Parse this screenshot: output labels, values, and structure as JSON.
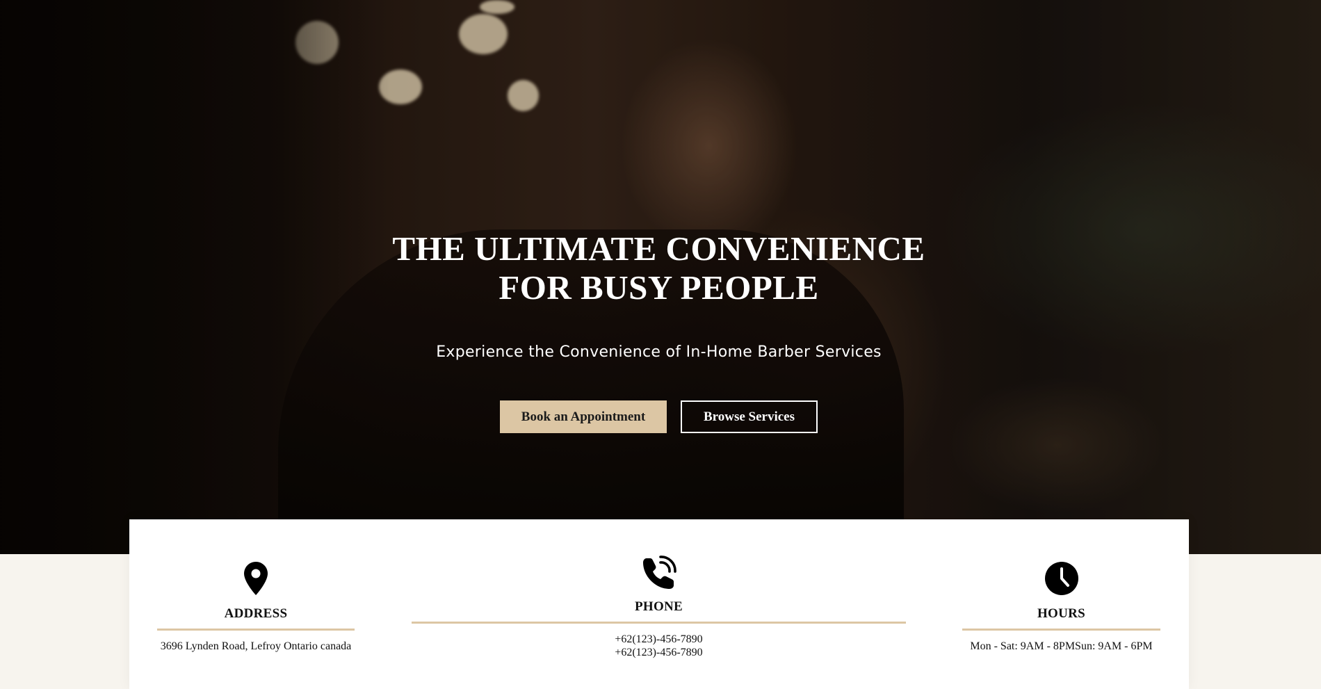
{
  "hero": {
    "title_line1": "THE ULTIMATE CONVENIENCE",
    "title_line2": "FOR BUSY PEOPLE",
    "subtitle": "Experience the Convenience of In-Home Barber Services",
    "primary_button": "Book an Appointment",
    "secondary_button": "Browse Services"
  },
  "info": {
    "address": {
      "icon": "map-pin-icon",
      "title": "ADDRESS",
      "text": "3696 Lynden Road, Lefroy Ontario canada"
    },
    "phone": {
      "icon": "phone-ringing-icon",
      "title": "PHONE",
      "lines": [
        "+62(123)-456-7890",
        "+62(123)-456-7890"
      ]
    },
    "hours": {
      "icon": "clock-icon",
      "title": "HOURS",
      "text": "Mon - Sat: 9AM - 8PMSun: 9AM - 6PM"
    }
  },
  "colors": {
    "accent": "#dcc6a4",
    "card_bg": "#ffffff",
    "page_bg": "#f7f4ee",
    "text_dark": "#111111"
  }
}
